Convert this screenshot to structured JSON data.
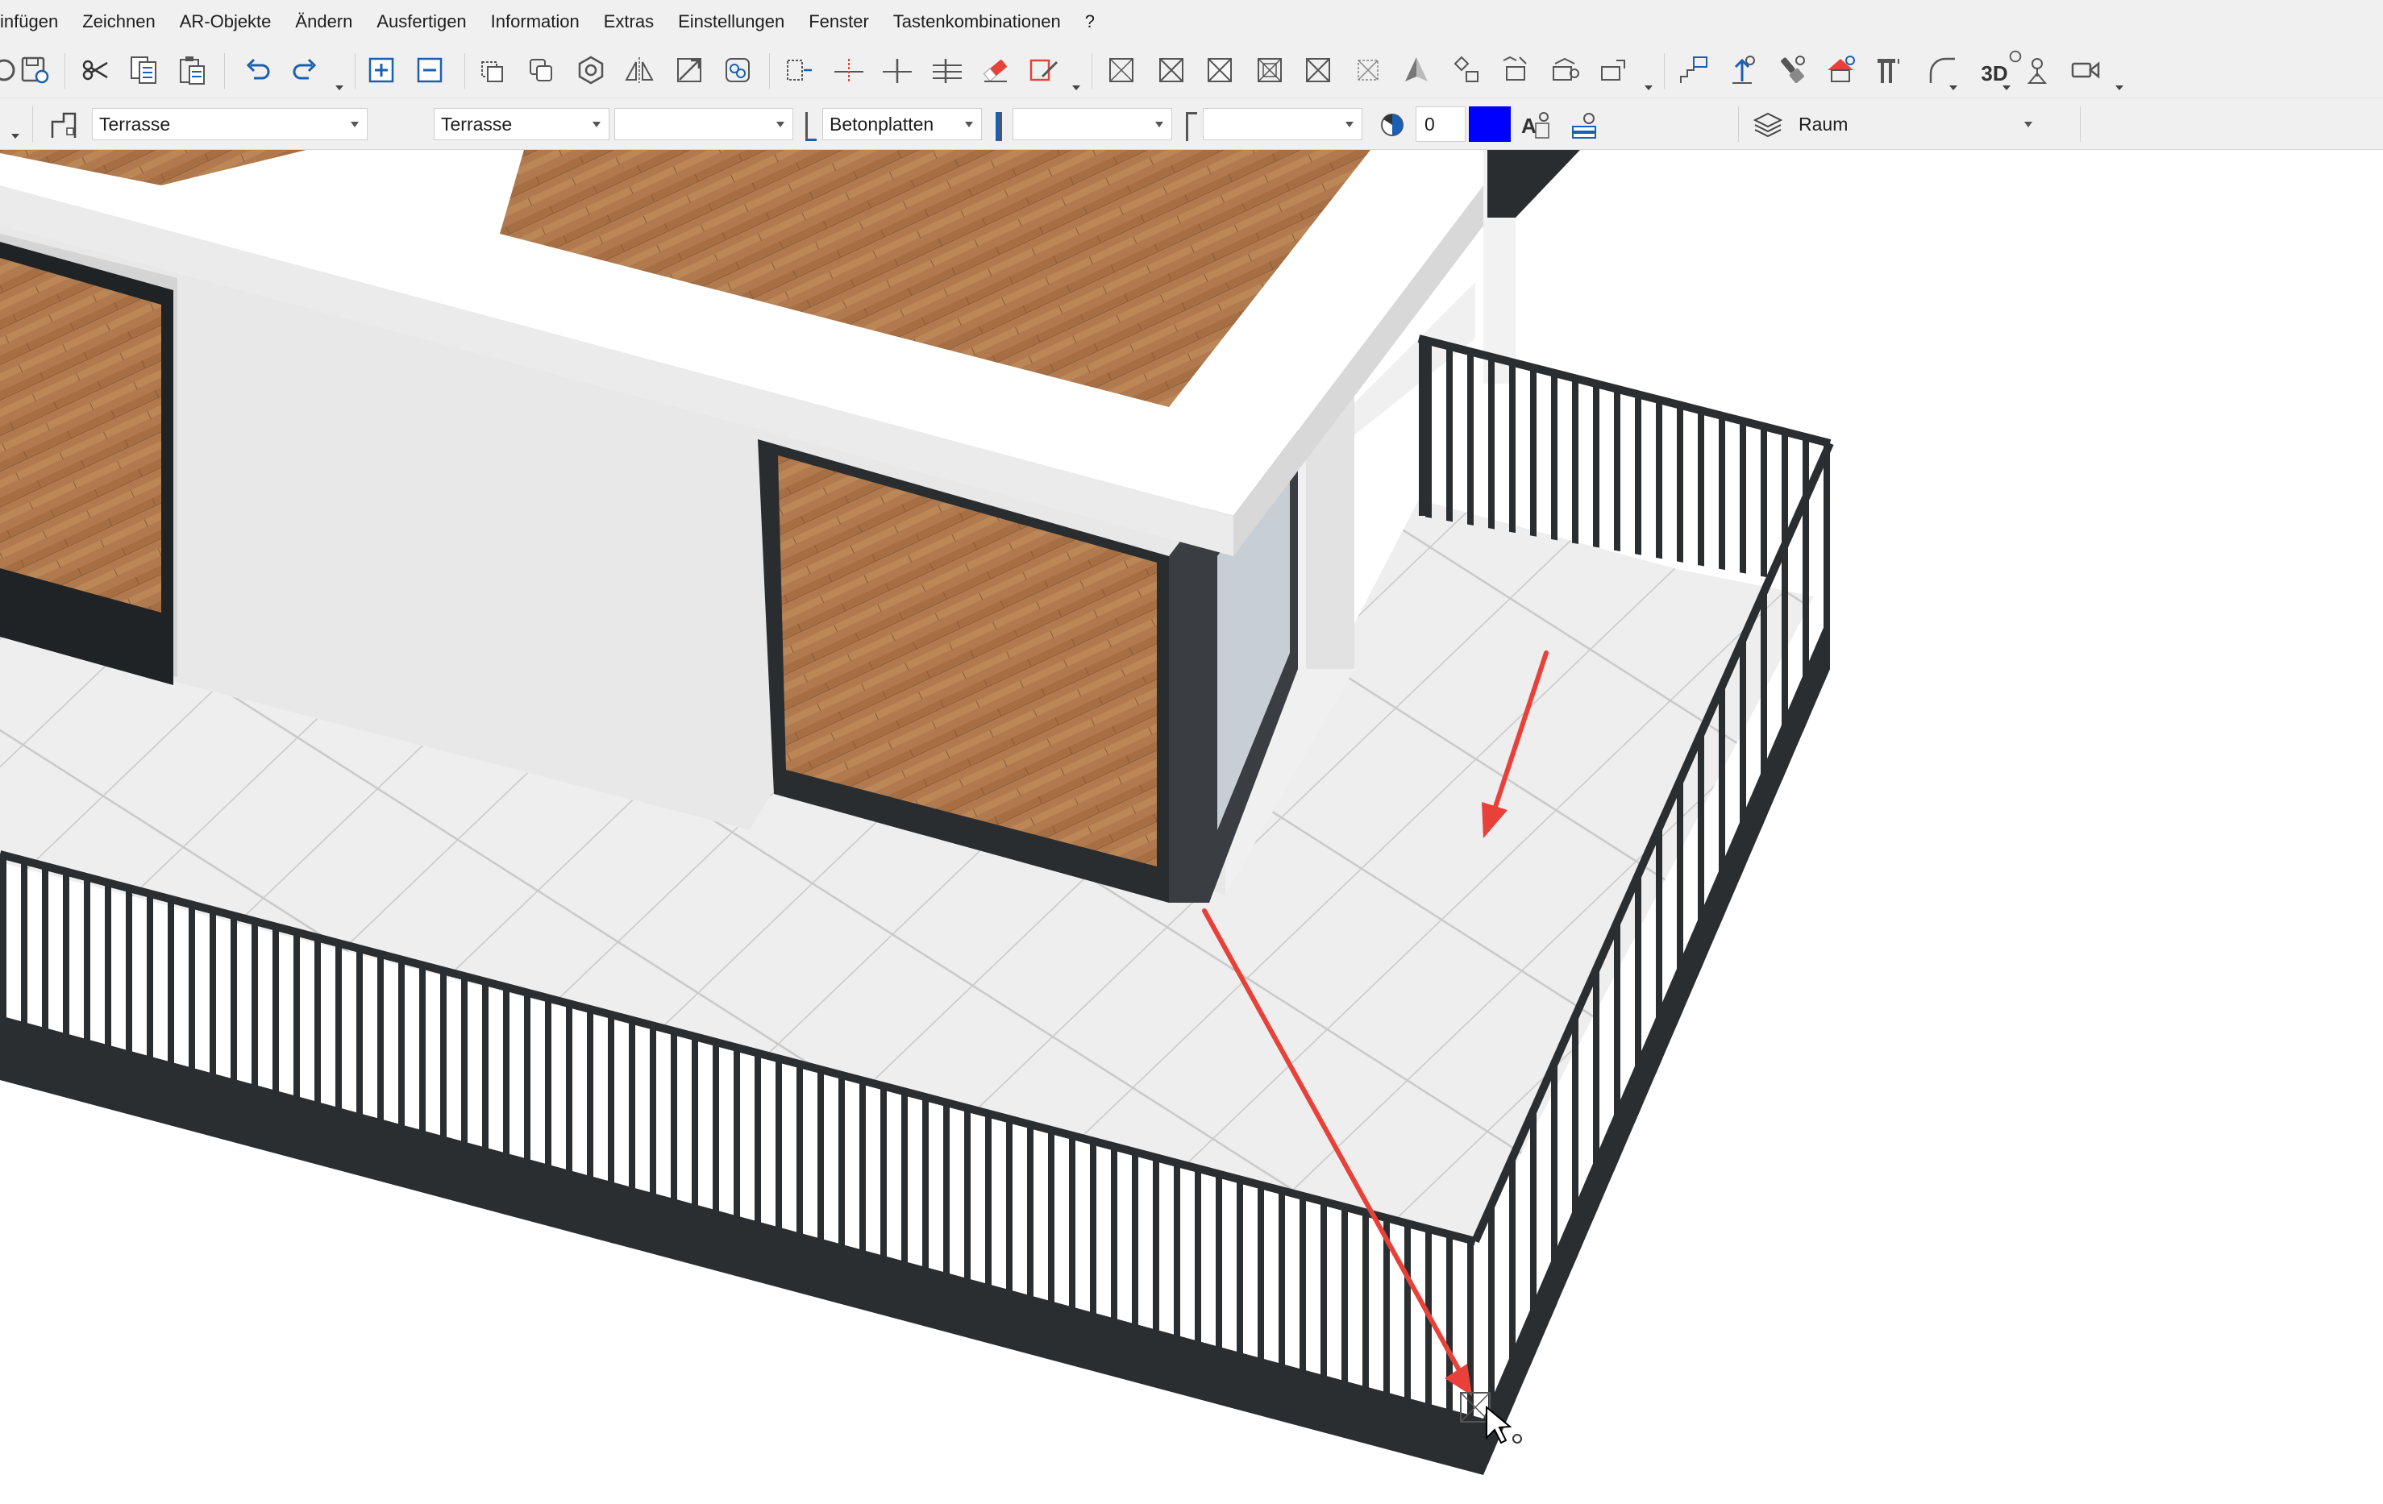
{
  "menu": {
    "items": [
      {
        "label": "infügen"
      },
      {
        "label": "Zeichnen"
      },
      {
        "label": "AR-Objekte"
      },
      {
        "label": "Ändern"
      },
      {
        "label": "Ausfertigen"
      },
      {
        "label": "Information"
      },
      {
        "label": "Extras"
      },
      {
        "label": "Einstellungen"
      },
      {
        "label": "Fenster"
      },
      {
        "label": "Tastenkombinationen"
      },
      {
        "label": "?"
      }
    ]
  },
  "toolbar": {
    "three_d_label": "3D"
  },
  "properties": {
    "element_type": "Terrasse",
    "layer_name": "Terrasse",
    "blank_combo_1": "",
    "material": "Betonplatten",
    "blank_combo_2": "",
    "blank_combo_3": "",
    "pen_number": "0",
    "pen_color": "#0000ff",
    "drawing_type": "Raum"
  },
  "colors": {
    "accent": "#1a5fb4",
    "arrow": "#e8413a",
    "railing": "#2b2e31"
  }
}
